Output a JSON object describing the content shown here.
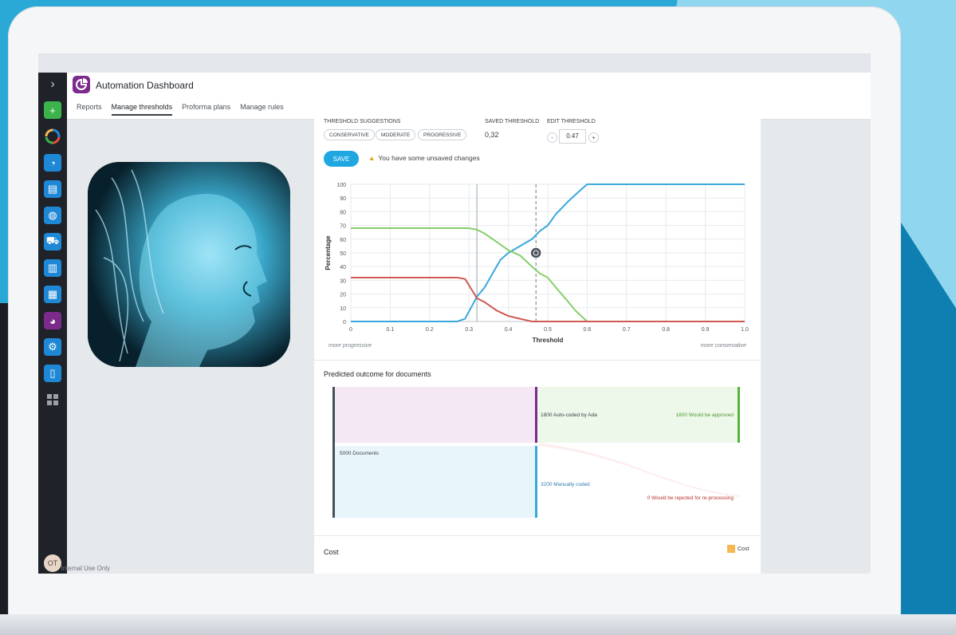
{
  "app": {
    "title": "Automation Dashboard",
    "tabs": [
      {
        "label": "Reports",
        "active": false
      },
      {
        "label": "Manage thresholds",
        "active": true
      },
      {
        "label": "Proforma plans",
        "active": false
      },
      {
        "label": "Manage rules",
        "active": false
      }
    ]
  },
  "sidebar": {
    "icons": [
      {
        "name": "add-icon",
        "color": "#3cb44b"
      },
      {
        "name": "ring-chart-icon",
        "color": "#1f2329"
      },
      {
        "name": "gauge-icon",
        "color": "#1e88d6"
      },
      {
        "name": "inbox-icon",
        "color": "#1e88d6"
      },
      {
        "name": "globe-icon",
        "color": "#1e88d6"
      },
      {
        "name": "cart-icon",
        "color": "#1e88d6"
      },
      {
        "name": "clipboard-icon",
        "color": "#1e88d6"
      },
      {
        "name": "building-icon",
        "color": "#1e88d6"
      },
      {
        "name": "pie-icon",
        "color": "#7c2a8c"
      },
      {
        "name": "settings-icon",
        "color": "#1e88d6"
      },
      {
        "name": "book-icon",
        "color": "#1e88d6"
      },
      {
        "name": "grid-icon",
        "color": "#1f2329"
      }
    ],
    "note": "For Internal Use Only",
    "avatar_initials": "OT"
  },
  "thresholds": {
    "suggestions_label": "THRESHOLD SUGGESTIONS",
    "chips": [
      "CONSERVATIVE",
      "MODERATE",
      "PROGRESSIVE"
    ],
    "saved_label": "SAVED THRESHOLD",
    "saved_value": "0,32",
    "edit_label": "EDIT THRESHOLD",
    "minus": "-",
    "plus": "+",
    "edit_value": "0.47",
    "save_label": "SAVE",
    "warning": "You have some unsaved changes"
  },
  "chart_data": {
    "type": "line",
    "xlabel": "Threshold",
    "ylabel": "Percentage",
    "xlim": [
      0,
      1.0
    ],
    "ylim": [
      0,
      100
    ],
    "x_ticks": [
      "0",
      "0.1",
      "0.2",
      "0.3",
      "0.4",
      "0.5",
      "0.6",
      "0.7",
      "0.8",
      "0.9",
      "1.0"
    ],
    "y_ticks": [
      "0",
      "10",
      "20",
      "30",
      "40",
      "50",
      "60",
      "70",
      "80",
      "90",
      "100"
    ],
    "grid": true,
    "left_note": "more progressive",
    "right_note": "more conservative",
    "saved_threshold": 0.32,
    "edit_threshold": 0.47,
    "series": [
      {
        "color": "#3aa8dc",
        "x": [
          0,
          0.27,
          0.29,
          0.32,
          0.34,
          0.36,
          0.38,
          0.4,
          0.43,
          0.46,
          0.48,
          0.5,
          0.52,
          0.55,
          0.58,
          0.6,
          0.65,
          0.8,
          1.0
        ],
        "y": [
          0,
          0,
          2,
          18,
          25,
          35,
          45,
          50,
          55,
          60,
          66,
          70,
          78,
          87,
          95,
          100,
          100,
          100,
          100
        ]
      },
      {
        "color": "#86cf6a",
        "x": [
          0,
          0.3,
          0.32,
          0.34,
          0.37,
          0.4,
          0.43,
          0.46,
          0.48,
          0.5,
          0.52,
          0.55,
          0.57,
          0.6,
          0.65,
          1.0
        ],
        "y": [
          68,
          68,
          67,
          64,
          58,
          52,
          48,
          40,
          35,
          32,
          25,
          15,
          8,
          0,
          0,
          0
        ]
      },
      {
        "color": "#cf5a52",
        "x": [
          0,
          0.27,
          0.29,
          0.32,
          0.34,
          0.37,
          0.4,
          0.43,
          0.46,
          0.5,
          0.6,
          1.0
        ],
        "y": [
          32,
          32,
          31,
          17,
          14,
          8,
          4,
          2,
          0,
          0,
          0,
          0
        ]
      }
    ]
  },
  "outcome": {
    "title": "Predicted outcome for documents",
    "nodes": {
      "total": "5000 Documents",
      "auto": "1800 Auto-coded by Ada",
      "manual": "3200 Manually coded",
      "approved": "1800 Would be approved",
      "rejected": "0 Would be rejected for re-processing"
    },
    "colors": {
      "auto": "#7c2a8c",
      "manual": "#3aa8dc",
      "approved": "#55b33b",
      "rejected": "#c8413b",
      "total": "#44515a"
    }
  },
  "cost": {
    "title": "Cost",
    "legend": "Cost",
    "legend_color": "#f6b651"
  }
}
